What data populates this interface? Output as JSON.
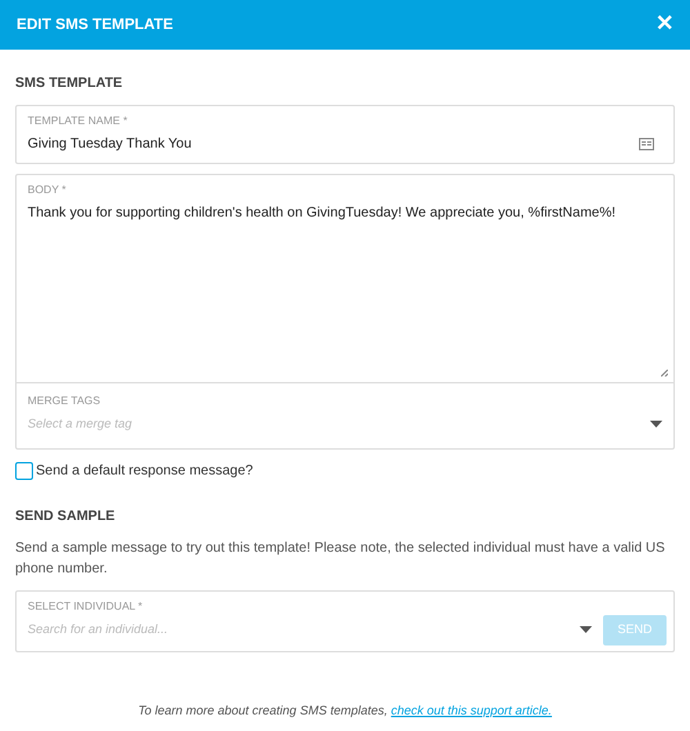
{
  "header": {
    "title": "EDIT SMS TEMPLATE",
    "close": "✕"
  },
  "template_section": {
    "title": "SMS TEMPLATE",
    "template_name": {
      "label": "TEMPLATE NAME *",
      "value": "Giving Tuesday Thank You"
    },
    "body": {
      "label": "BODY *",
      "value": "Thank you for supporting children's health on GivingTuesday! We appreciate you, %firstName%!"
    },
    "merge_tags": {
      "label": "MERGE TAGS",
      "placeholder": "Select a merge tag"
    },
    "default_response": {
      "label": "Send a default response message?",
      "checked": false
    }
  },
  "send_sample": {
    "title": "SEND SAMPLE",
    "description": "Send a sample message to try out this template! Please note, the selected individual must have a valid US phone number.",
    "individual": {
      "label": "SELECT INDIVIDUAL *",
      "placeholder": "Search for an individual..."
    },
    "send_button": {
      "label": "SEND",
      "disabled": true
    }
  },
  "footer": {
    "text": "To learn more about creating SMS templates,",
    "link": "check out this support article."
  }
}
